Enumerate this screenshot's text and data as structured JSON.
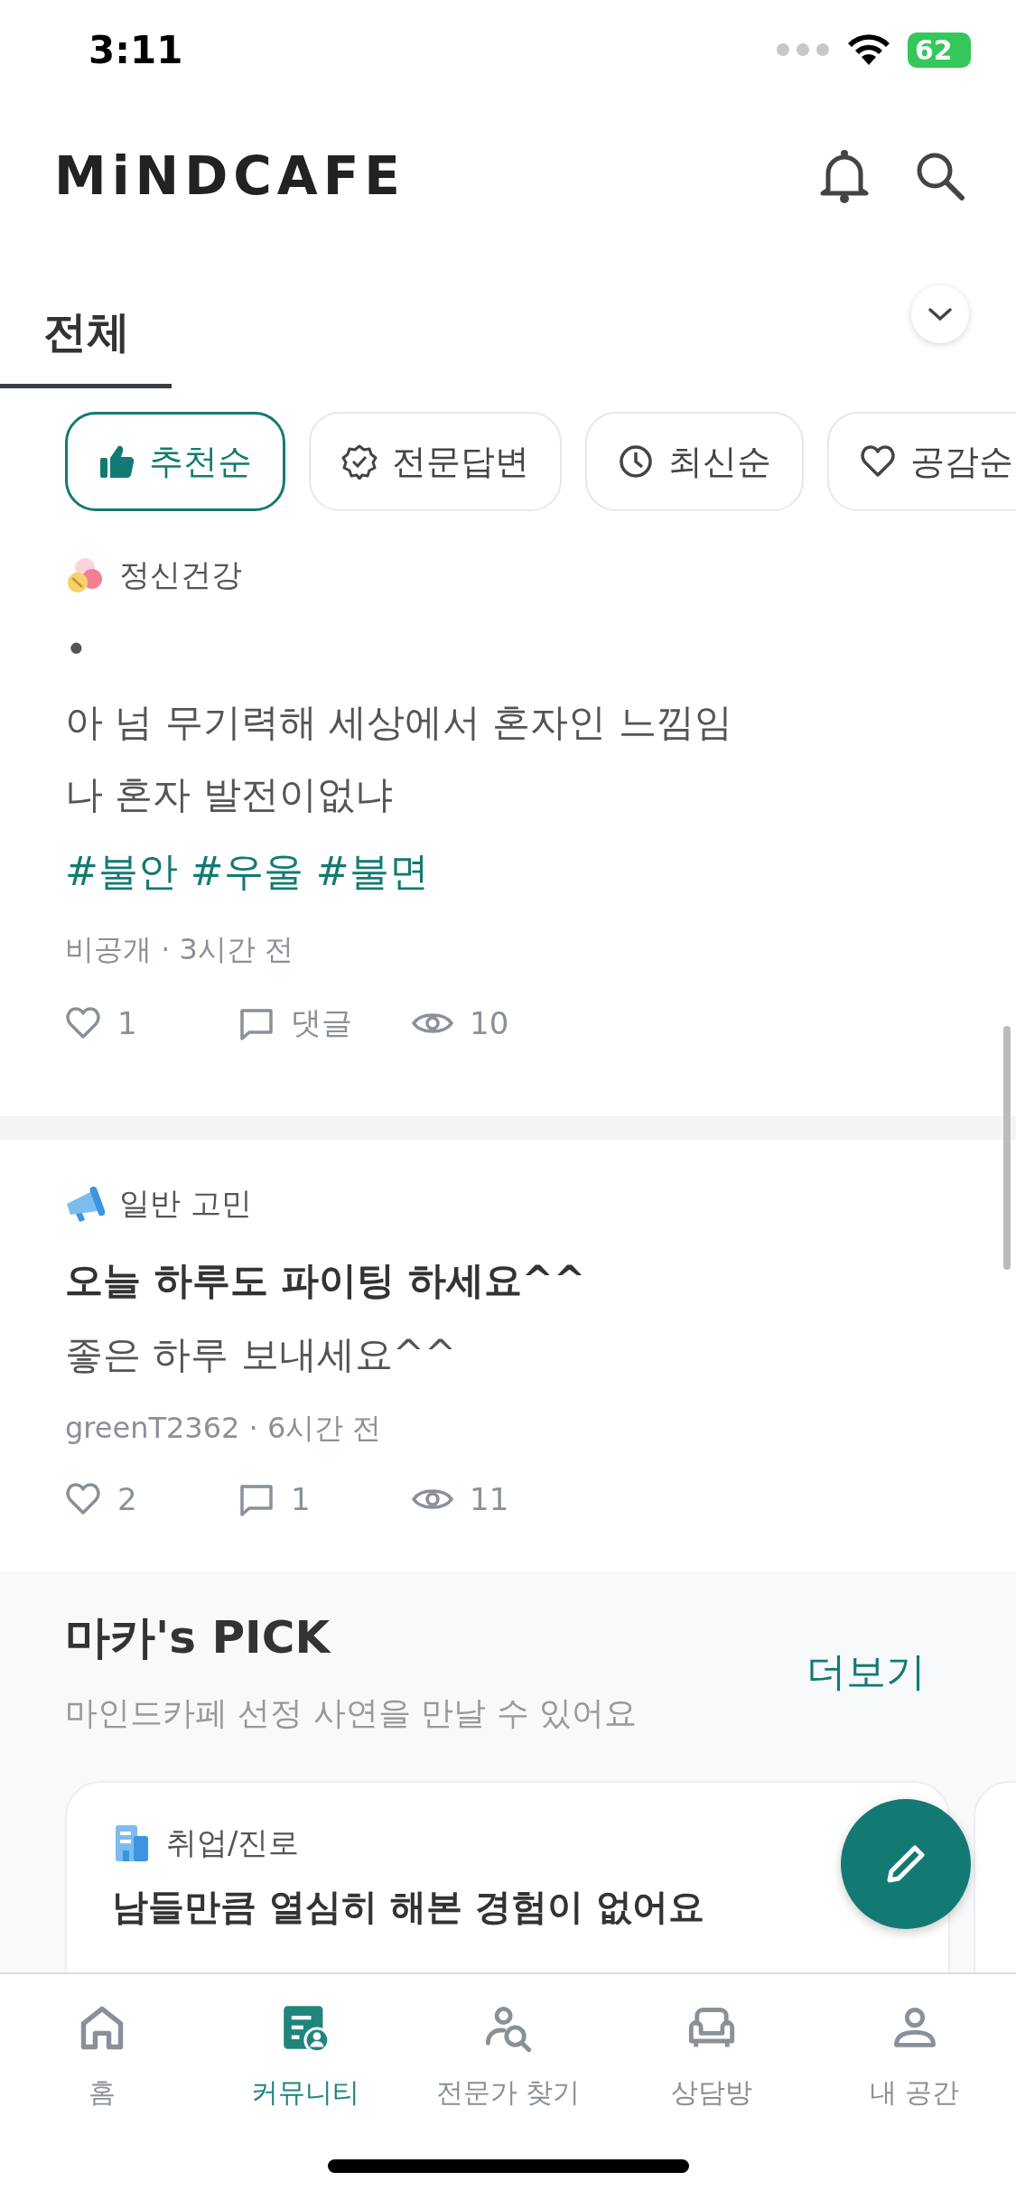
{
  "status_bar": {
    "time": "3:11",
    "battery": "62"
  },
  "header": {
    "logo": "MiNDCAFE"
  },
  "tabs": [
    {
      "label": "전체",
      "selected": true
    }
  ],
  "sort_chips": [
    {
      "label": "추천순",
      "selected": true
    },
    {
      "label": "전문답변",
      "selected": false
    },
    {
      "label": "최신순",
      "selected": false
    },
    {
      "label": "공감순",
      "selected": false
    }
  ],
  "posts": [
    {
      "category": "정신건강",
      "body": [
        "•",
        "아 넘 무기력해 세상에서 혼자인 느낌임",
        "나 혼자 발전이없냐"
      ],
      "tags": "#불안 #우울 #불면",
      "meta": "비공개 · 3시간 전",
      "likes": "1",
      "comments": "댓글",
      "views": "10"
    },
    {
      "category": "일반 고민",
      "title": "오늘 하루도 파이팅 하세요^^",
      "body": [
        "좋은 하루 보내세요^^"
      ],
      "meta": "greenT2362 · 6시간 전",
      "likes": "2",
      "comments": "1",
      "views": "11"
    }
  ],
  "pick": {
    "title": "마카's PICK",
    "subtitle": "마인드카페 선정 사연을 만날 수 있어요",
    "more": "더보기",
    "cards": [
      {
        "category": "취업/진로",
        "title": "남들만큼 열심히 해본 경험이 없어요"
      }
    ]
  },
  "nav": [
    {
      "label": "홈",
      "selected": false
    },
    {
      "label": "커뮤니티",
      "selected": true
    },
    {
      "label": "전문가 찾기",
      "selected": false
    },
    {
      "label": "상담방",
      "selected": false
    },
    {
      "label": "내 공간",
      "selected": false
    }
  ]
}
